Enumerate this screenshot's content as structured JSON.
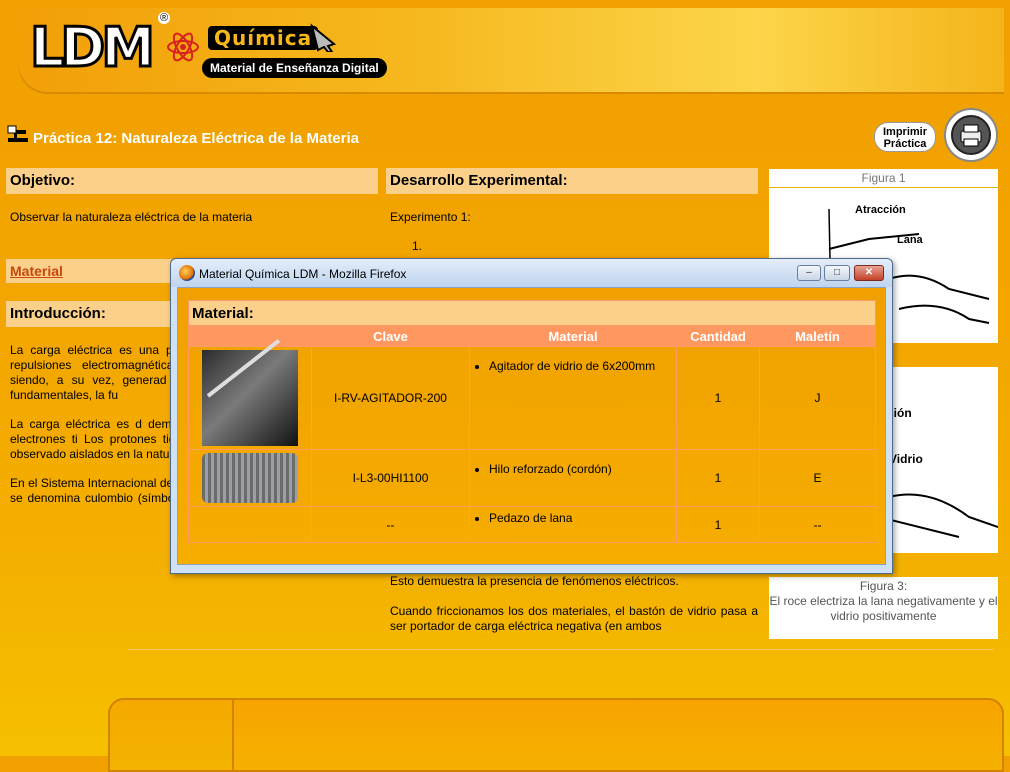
{
  "header": {
    "logo_text": "LDM",
    "logo_brand": "Química",
    "logo_tagline": "Material de Enseñanza Digital"
  },
  "page": {
    "title": "Práctica 12: Naturaleza Eléctrica de la Materia",
    "print_label": "Imprimir Práctica"
  },
  "left": {
    "objective_heading": "Objetivo:",
    "objective_text": "Observar la naturaleza eléctrica de la materia",
    "material_link": "Material",
    "intro_heading": "Introducción:",
    "intro_p1": "La carga eléctrica es una partículas sub-atómicas atracciones y repulsiones electromagnéticas entre eléctricamente es influida siendo, a su vez, generad carga y campo eléctrico e fuerzas fundamentales, la fu",
    "intro_p2": "La carga eléctrica es d demostrado experimentalm definición, los electrones ti Los protones tienen la car tienen carga fraccionaria observado aislados en la naturaleza.",
    "intro_p3": "En el Sistema Internacional de Unidades la unidad de carga eléctrica se denomina culombio (símbolo C). Se define como la cantidad de carga que pasa por una sección en 1 segundo"
  },
  "middle": {
    "dev_heading": "Desarrollo Experimental:",
    "experiment_label": "Experimento 1:",
    "step_1": "1.",
    "result_text": "Esto demuestra la presencia de fenómenos eléctricos.",
    "friction_text": "Cuando friccionamos los dos materiales, el bastón de vidrio pasa a ser portador de carga eléctrica negativa (en ambos"
  },
  "right": {
    "fig1_caption": "Figura 1",
    "fig1_label_a": "Atracción",
    "fig1_label_b": "Lana",
    "fig2_caption": "a 2",
    "fig2_label_a": "sión",
    "fig2_label_b": "Vidrio",
    "fig3_caption": "Figura 3:",
    "fig3_desc": "El roce electriza la lana negativamente y el vidrio positivamente"
  },
  "popup": {
    "window_title": "Material Química LDM - Mozilla Firefox",
    "min_label": "–",
    "max_label": "□",
    "close_label": "✕",
    "table_title": "Material:",
    "columns": [
      "Clave",
      "Material",
      "Cantidad",
      "Maletín"
    ],
    "rows": [
      {
        "clave": "I-RV-AGITADOR-200",
        "material": "Agitador de vidrio de 6x200mm",
        "cantidad": "1",
        "maletin": "J"
      },
      {
        "clave": "I-L3-00HI1100",
        "material": "Hilo reforzado (cordón)",
        "cantidad": "1",
        "maletin": "E"
      },
      {
        "clave": "--",
        "material": "Pedazo de lana",
        "cantidad": "1",
        "maletin": "--"
      }
    ]
  },
  "colors": {
    "background": "#f0a000",
    "section_header": "#fbd08a",
    "table_header": "#ff9860",
    "link": "#c8490d"
  }
}
